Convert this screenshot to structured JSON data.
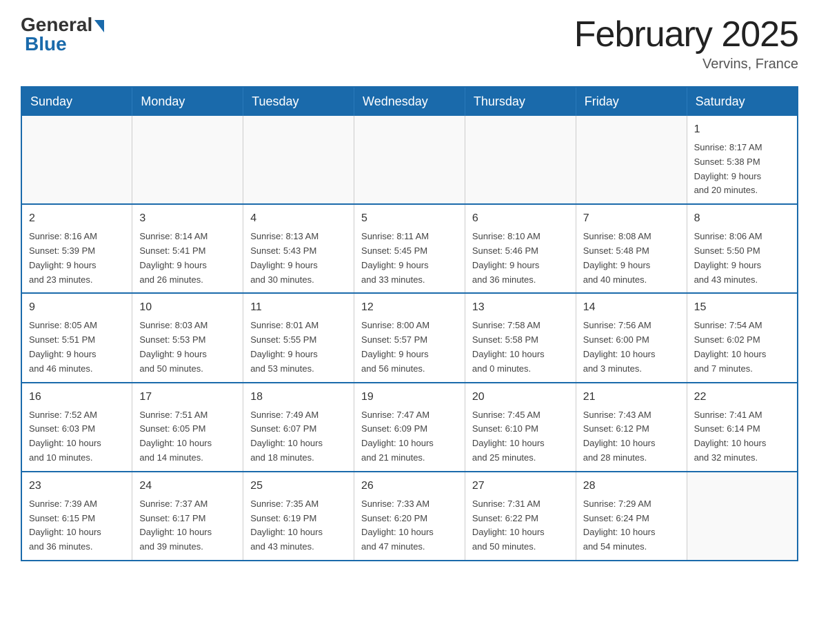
{
  "header": {
    "logo_general": "General",
    "logo_blue": "Blue",
    "title": "February 2025",
    "location": "Vervins, France"
  },
  "days_of_week": [
    "Sunday",
    "Monday",
    "Tuesday",
    "Wednesday",
    "Thursday",
    "Friday",
    "Saturday"
  ],
  "weeks": [
    [
      {
        "day": "",
        "info": ""
      },
      {
        "day": "",
        "info": ""
      },
      {
        "day": "",
        "info": ""
      },
      {
        "day": "",
        "info": ""
      },
      {
        "day": "",
        "info": ""
      },
      {
        "day": "",
        "info": ""
      },
      {
        "day": "1",
        "info": "Sunrise: 8:17 AM\nSunset: 5:38 PM\nDaylight: 9 hours\nand 20 minutes."
      }
    ],
    [
      {
        "day": "2",
        "info": "Sunrise: 8:16 AM\nSunset: 5:39 PM\nDaylight: 9 hours\nand 23 minutes."
      },
      {
        "day": "3",
        "info": "Sunrise: 8:14 AM\nSunset: 5:41 PM\nDaylight: 9 hours\nand 26 minutes."
      },
      {
        "day": "4",
        "info": "Sunrise: 8:13 AM\nSunset: 5:43 PM\nDaylight: 9 hours\nand 30 minutes."
      },
      {
        "day": "5",
        "info": "Sunrise: 8:11 AM\nSunset: 5:45 PM\nDaylight: 9 hours\nand 33 minutes."
      },
      {
        "day": "6",
        "info": "Sunrise: 8:10 AM\nSunset: 5:46 PM\nDaylight: 9 hours\nand 36 minutes."
      },
      {
        "day": "7",
        "info": "Sunrise: 8:08 AM\nSunset: 5:48 PM\nDaylight: 9 hours\nand 40 minutes."
      },
      {
        "day": "8",
        "info": "Sunrise: 8:06 AM\nSunset: 5:50 PM\nDaylight: 9 hours\nand 43 minutes."
      }
    ],
    [
      {
        "day": "9",
        "info": "Sunrise: 8:05 AM\nSunset: 5:51 PM\nDaylight: 9 hours\nand 46 minutes."
      },
      {
        "day": "10",
        "info": "Sunrise: 8:03 AM\nSunset: 5:53 PM\nDaylight: 9 hours\nand 50 minutes."
      },
      {
        "day": "11",
        "info": "Sunrise: 8:01 AM\nSunset: 5:55 PM\nDaylight: 9 hours\nand 53 minutes."
      },
      {
        "day": "12",
        "info": "Sunrise: 8:00 AM\nSunset: 5:57 PM\nDaylight: 9 hours\nand 56 minutes."
      },
      {
        "day": "13",
        "info": "Sunrise: 7:58 AM\nSunset: 5:58 PM\nDaylight: 10 hours\nand 0 minutes."
      },
      {
        "day": "14",
        "info": "Sunrise: 7:56 AM\nSunset: 6:00 PM\nDaylight: 10 hours\nand 3 minutes."
      },
      {
        "day": "15",
        "info": "Sunrise: 7:54 AM\nSunset: 6:02 PM\nDaylight: 10 hours\nand 7 minutes."
      }
    ],
    [
      {
        "day": "16",
        "info": "Sunrise: 7:52 AM\nSunset: 6:03 PM\nDaylight: 10 hours\nand 10 minutes."
      },
      {
        "day": "17",
        "info": "Sunrise: 7:51 AM\nSunset: 6:05 PM\nDaylight: 10 hours\nand 14 minutes."
      },
      {
        "day": "18",
        "info": "Sunrise: 7:49 AM\nSunset: 6:07 PM\nDaylight: 10 hours\nand 18 minutes."
      },
      {
        "day": "19",
        "info": "Sunrise: 7:47 AM\nSunset: 6:09 PM\nDaylight: 10 hours\nand 21 minutes."
      },
      {
        "day": "20",
        "info": "Sunrise: 7:45 AM\nSunset: 6:10 PM\nDaylight: 10 hours\nand 25 minutes."
      },
      {
        "day": "21",
        "info": "Sunrise: 7:43 AM\nSunset: 6:12 PM\nDaylight: 10 hours\nand 28 minutes."
      },
      {
        "day": "22",
        "info": "Sunrise: 7:41 AM\nSunset: 6:14 PM\nDaylight: 10 hours\nand 32 minutes."
      }
    ],
    [
      {
        "day": "23",
        "info": "Sunrise: 7:39 AM\nSunset: 6:15 PM\nDaylight: 10 hours\nand 36 minutes."
      },
      {
        "day": "24",
        "info": "Sunrise: 7:37 AM\nSunset: 6:17 PM\nDaylight: 10 hours\nand 39 minutes."
      },
      {
        "day": "25",
        "info": "Sunrise: 7:35 AM\nSunset: 6:19 PM\nDaylight: 10 hours\nand 43 minutes."
      },
      {
        "day": "26",
        "info": "Sunrise: 7:33 AM\nSunset: 6:20 PM\nDaylight: 10 hours\nand 47 minutes."
      },
      {
        "day": "27",
        "info": "Sunrise: 7:31 AM\nSunset: 6:22 PM\nDaylight: 10 hours\nand 50 minutes."
      },
      {
        "day": "28",
        "info": "Sunrise: 7:29 AM\nSunset: 6:24 PM\nDaylight: 10 hours\nand 54 minutes."
      },
      {
        "day": "",
        "info": ""
      }
    ]
  ]
}
